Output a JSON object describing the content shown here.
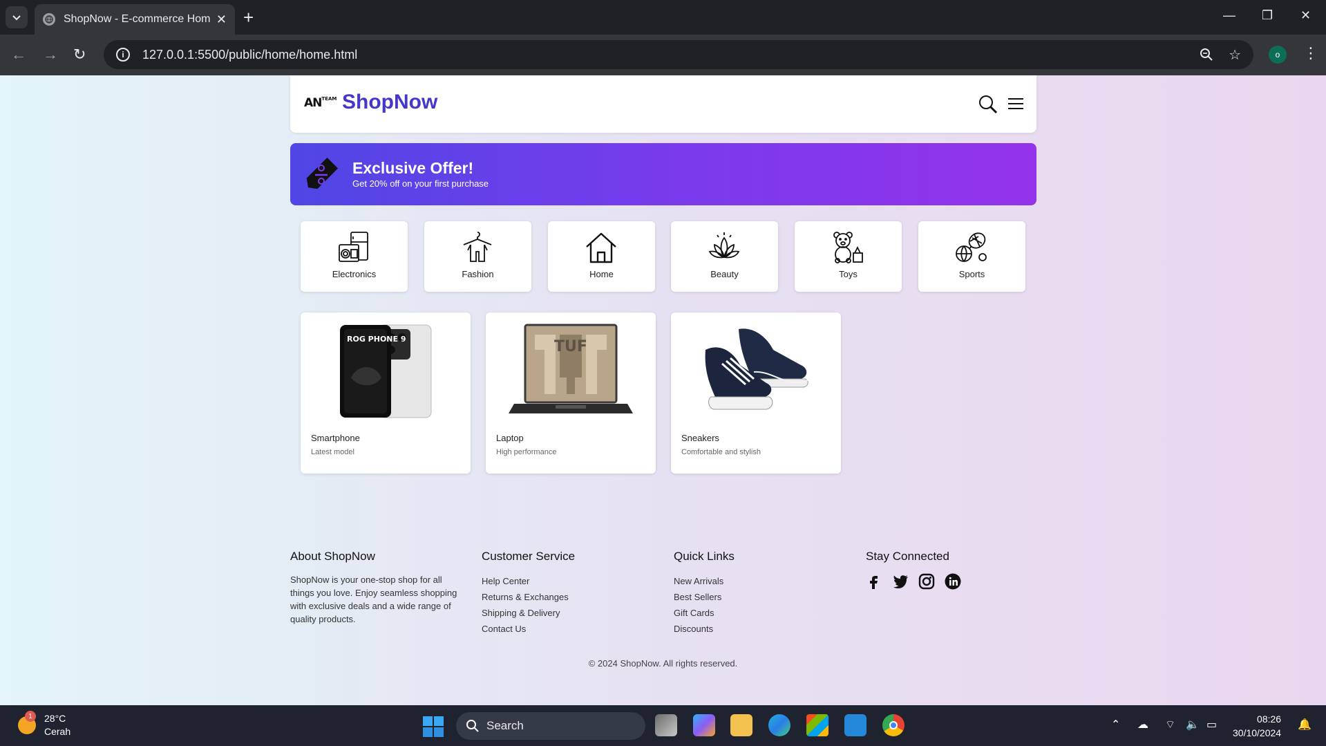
{
  "browser": {
    "tab_title": "ShopNow - E-commerce Home",
    "url": "127.0.0.1:5500/public/home/home.html",
    "profile_initial": "o"
  },
  "header": {
    "logo_text": "AN",
    "logo_small": "TEAM",
    "brand": "ShopNow"
  },
  "offer": {
    "title": "Exclusive Offer!",
    "subtitle": "Get 20% off on your first purchase",
    "accent": "#6d3ae8"
  },
  "categories": [
    {
      "label": "Electronics",
      "icon": "appliances-icon"
    },
    {
      "label": "Fashion",
      "icon": "clothes-hanger-icon"
    },
    {
      "label": "Home",
      "icon": "house-icon"
    },
    {
      "label": "Beauty",
      "icon": "lotus-icon"
    },
    {
      "label": "Toys",
      "icon": "teddy-bear-icon"
    },
    {
      "label": "Sports",
      "icon": "sports-balls-icon"
    }
  ],
  "products": [
    {
      "name": "Smartphone",
      "desc": "Latest model",
      "image_text": "ROG PHONE 9"
    },
    {
      "name": "Laptop",
      "desc": "High performance",
      "image_text": "TUF"
    },
    {
      "name": "Sneakers",
      "desc": "Comfortable and stylish"
    }
  ],
  "footer": {
    "about": {
      "title": "About ShopNow",
      "text": "ShopNow is your one-stop shop for all things you love. Enjoy seamless shopping with exclusive deals and a wide range of quality products."
    },
    "service": {
      "title": "Customer Service",
      "links": [
        "Help Center",
        "Returns & Exchanges",
        "Shipping & Delivery",
        "Contact Us"
      ]
    },
    "quick": {
      "title": "Quick Links",
      "links": [
        "New Arrivals",
        "Best Sellers",
        "Gift Cards",
        "Discounts"
      ]
    },
    "social": {
      "title": "Stay Connected",
      "icons": [
        "facebook-icon",
        "twitter-icon",
        "instagram-icon",
        "linkedin-icon"
      ]
    },
    "copyright": "© 2024 ShopNow. All rights reserved."
  },
  "taskbar": {
    "temp": "28°C",
    "condition": "Cerah",
    "badge": "1",
    "search_label": "Search",
    "time": "08:26",
    "date": "30/10/2024"
  }
}
